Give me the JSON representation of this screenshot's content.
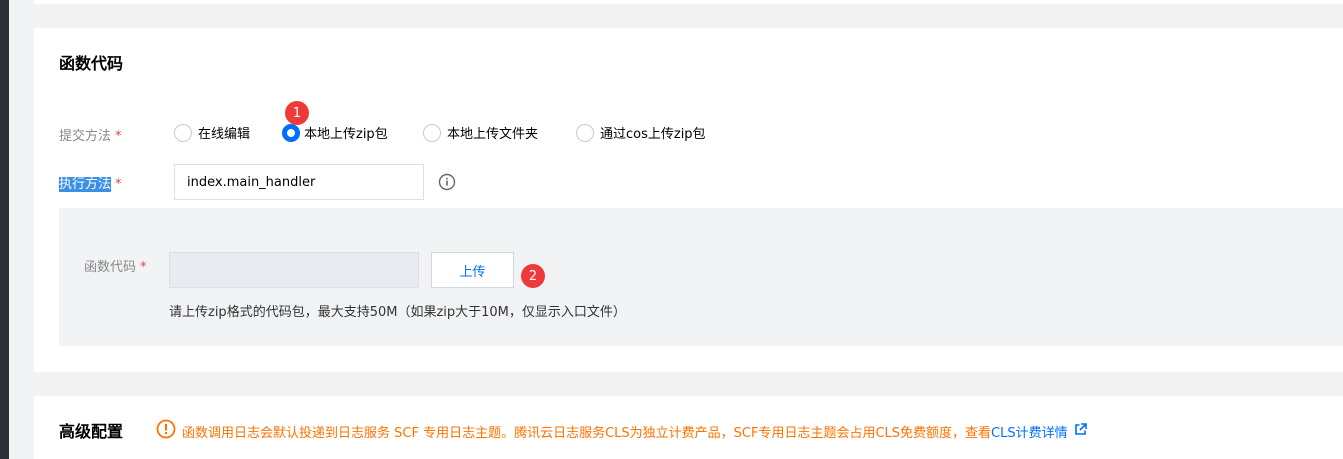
{
  "colors": {
    "accent": "#006eff",
    "required": "#e54545",
    "warning": "#ff7200",
    "badge": "#ee3a3a"
  },
  "function_code": {
    "title": "函数代码",
    "submit_method": {
      "label": "提交方法",
      "required_mark": "*",
      "options": [
        "在线编辑",
        "本地上传zip包",
        "本地上传文件夹",
        "通过cos上传zip包"
      ],
      "selected": "本地上传zip包"
    },
    "handler": {
      "label": "执行方法",
      "required_mark": "*",
      "value": "index.main_handler",
      "icon": "info-icon"
    },
    "upload": {
      "label": "函数代码",
      "required_mark": "*",
      "button_label": "上传",
      "hint": "请上传zip格式的代码包，最大支持50M（如果zip大于10M，仅显示入口文件）"
    },
    "badges": [
      "1",
      "2"
    ]
  },
  "advanced": {
    "title": "高级配置",
    "notice_icon": "warning-circle-icon",
    "notice": "函数调用日志会默认投递到日志服务 SCF 专用日志主题。腾讯云日志服务CLS为独立计费产品，SCF专用日志主题会占用CLS免费额度，查看",
    "link": "CLS计费详情",
    "link_icon": "external-link-icon"
  }
}
